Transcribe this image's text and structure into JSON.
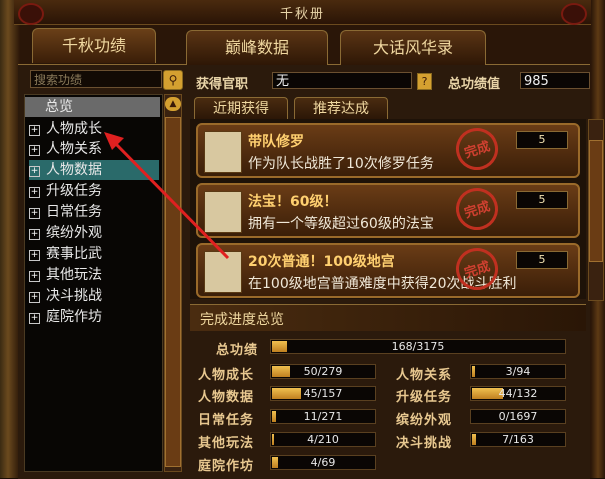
{
  "window": {
    "title": "千秋册"
  },
  "main_tabs": [
    {
      "label": "千秋功绩",
      "active": true
    },
    {
      "label": "巅峰数据",
      "active": false
    },
    {
      "label": "大话风华录",
      "active": false
    }
  ],
  "search": {
    "placeholder": "搜索功绩",
    "button_icon": "search-icon"
  },
  "categories": {
    "header": "总览",
    "items": [
      {
        "label": "人物成长"
      },
      {
        "label": "人物关系"
      },
      {
        "label": "人物数据",
        "selected": true
      },
      {
        "label": "升级任务"
      },
      {
        "label": "日常任务"
      },
      {
        "label": "缤纷外观"
      },
      {
        "label": "赛事比武"
      },
      {
        "label": "其他玩法"
      },
      {
        "label": "决斗挑战"
      },
      {
        "label": "庭院作坊"
      }
    ]
  },
  "info": {
    "official_label": "获得官职",
    "official_value": "无",
    "help_label": "?",
    "total_label": "总功绩值",
    "total_value": "985"
  },
  "sub_tabs": [
    {
      "label": "近期获得",
      "active": true
    },
    {
      "label": "推荐达成",
      "active": false
    }
  ],
  "achievements": [
    {
      "title": "带队修罗",
      "desc": "作为队长战胜了10次修罗任务",
      "points": "5",
      "stamp": "完成"
    },
    {
      "title": "法宝！60级！",
      "desc": "拥有一个等级超过60级的法宝",
      "points": "5",
      "stamp": "完成"
    },
    {
      "title": "20次普通！100级地宫",
      "desc": "在100级地宫普通难度中获得20次战斗胜利",
      "points": "5",
      "stamp": "完成"
    }
  ],
  "progress": {
    "header": "完成进度总览",
    "total": {
      "label": "总功绩",
      "text": "168/3175",
      "value": 168,
      "max": 3175
    },
    "rows": [
      {
        "label": "人物成长",
        "text": "50/279",
        "value": 50,
        "max": 279
      },
      {
        "label": "人物关系",
        "text": "3/94",
        "value": 3,
        "max": 94
      },
      {
        "label": "人物数据",
        "text": "45/157",
        "value": 45,
        "max": 157
      },
      {
        "label": "升级任务",
        "text": "44/132",
        "value": 44,
        "max": 132
      },
      {
        "label": "日常任务",
        "text": "11/271",
        "value": 11,
        "max": 271
      },
      {
        "label": "缤纷外观",
        "text": "0/1697",
        "value": 0,
        "max": 1697
      },
      {
        "label": "其他玩法",
        "text": "4/210",
        "value": 4,
        "max": 210
      },
      {
        "label": "决斗挑战",
        "text": "7/163",
        "value": 7,
        "max": 163
      },
      {
        "label": "庭院作坊",
        "text": "4/69",
        "value": 4,
        "max": 69
      }
    ]
  },
  "colors": {
    "accent": "#d4a030",
    "selected": "#2a6a6a",
    "stamp": "#c03020",
    "arrow": "#e02020"
  }
}
